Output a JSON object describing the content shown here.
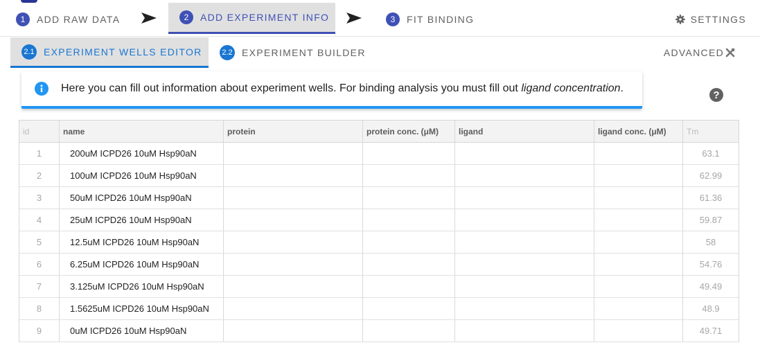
{
  "steps": [
    {
      "num": "1",
      "label": "ADD RAW DATA"
    },
    {
      "num": "2",
      "label": "ADD EXPERIMENT INFO"
    },
    {
      "num": "3",
      "label": "FIT BINDING"
    }
  ],
  "settings_label": "SETTINGS",
  "subtabs": [
    {
      "num": "2.1",
      "label": "EXPERIMENT WELLS EDITOR"
    },
    {
      "num": "2.2",
      "label": "EXPERIMENT BUILDER"
    }
  ],
  "advanced_label": "ADVANCED",
  "alert": {
    "text": "Here you can fill out information about experiment wells. For binding analysis you must fill out ",
    "emphasis": "ligand concentration",
    "end": "."
  },
  "help_icon": "?",
  "table": {
    "headers": [
      "id",
      "name",
      "protein",
      "protein conc. (μM)",
      "ligand",
      "ligand conc. (μM)",
      "Tm"
    ],
    "rows": [
      [
        "1",
        "200uM ICPD26 10uM Hsp90aN",
        "",
        "",
        "",
        "",
        "63.1"
      ],
      [
        "2",
        "100uM ICPD26 10uM Hsp90aN",
        "",
        "",
        "",
        "",
        "62.99"
      ],
      [
        "3",
        "50uM ICPD26 10uM Hsp90aN",
        "",
        "",
        "",
        "",
        "61.36"
      ],
      [
        "4",
        "25uM ICPD26 10uM Hsp90aN",
        "",
        "",
        "",
        "",
        "59.87"
      ],
      [
        "5",
        "12.5uM ICPD26 10uM Hsp90aN",
        "",
        "",
        "",
        "",
        "58"
      ],
      [
        "6",
        "6.25uM ICPD26 10uM Hsp90aN",
        "",
        "",
        "",
        "",
        "54.76"
      ],
      [
        "7",
        "3.125uM ICPD26 10uM Hsp90aN",
        "",
        "",
        "",
        "",
        "49.49"
      ],
      [
        "8",
        "1.5625uM ICPD26 10uM Hsp90aN",
        "",
        "",
        "",
        "",
        "48.9"
      ],
      [
        "9",
        "0uM ICPD26 10uM Hsp90aN",
        "",
        "",
        "",
        "",
        "49.71"
      ]
    ]
  },
  "colors": {
    "primary": "#3f51b5",
    "accent": "#1976d2",
    "info": "#2196f3"
  },
  "icons": [
    "next-arrow-icon",
    "gear-icon",
    "tools-icon",
    "info-icon",
    "help-icon"
  ]
}
